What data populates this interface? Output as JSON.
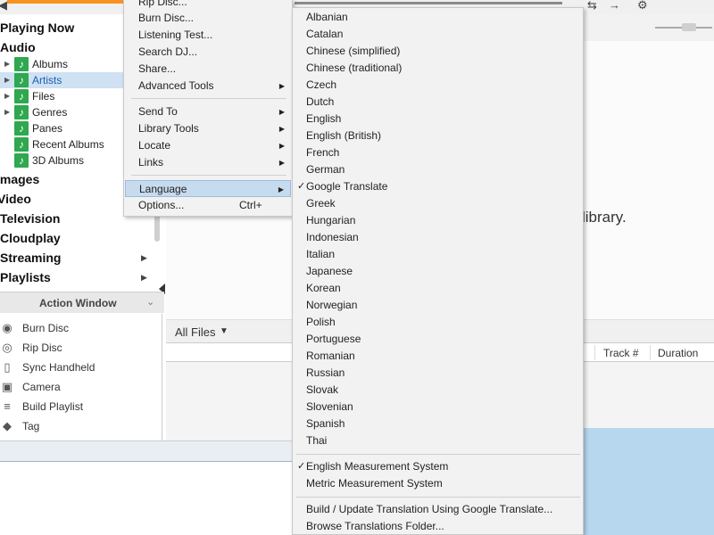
{
  "colors": {
    "progress": "#f7931e",
    "selected_row": "#cfe1f3",
    "menu_highlight": "#c7dbef",
    "note_icon": "#2fa84f"
  },
  "topbar": {
    "icons": [
      "speaker-icon",
      "swap-arrows-icon",
      "gear-icon"
    ]
  },
  "sidebar": {
    "categories": [
      {
        "label": "Playing Now"
      },
      {
        "label": "Audio"
      },
      {
        "label": "Images"
      },
      {
        "label": "Video"
      },
      {
        "label": "Television"
      },
      {
        "label": "Cloudplay"
      },
      {
        "label": "Streaming"
      },
      {
        "label": "Playlists"
      }
    ],
    "audio_items": [
      {
        "label": "Albums"
      },
      {
        "label": "Artists"
      },
      {
        "label": "Files"
      },
      {
        "label": "Genres"
      },
      {
        "label": "Panes"
      },
      {
        "label": "Recent Albums"
      },
      {
        "label": "3D Albums"
      }
    ]
  },
  "action_window": {
    "title": "Action Window",
    "items": [
      {
        "label": "Burn Disc",
        "icon": "disc-icon"
      },
      {
        "label": "Rip Disc",
        "icon": "rip-disc-icon"
      },
      {
        "label": "Sync Handheld",
        "icon": "phone-icon"
      },
      {
        "label": "Camera",
        "icon": "camera-icon"
      },
      {
        "label": "Build Playlist",
        "icon": "playlist-icon"
      },
      {
        "label": "Tag",
        "icon": "tag-icon"
      }
    ]
  },
  "main": {
    "library_text": "library.",
    "files_label": "All Files",
    "columns": {
      "track": "Track #",
      "duration": "Duration"
    }
  },
  "context_menu": {
    "items": [
      {
        "label": "Rip Disc..."
      },
      {
        "label": "Burn Disc..."
      },
      {
        "label": "Listening Test..."
      },
      {
        "label": "Search DJ..."
      },
      {
        "label": "Share..."
      },
      {
        "label": "Advanced Tools"
      },
      {
        "label": "Send To"
      },
      {
        "label": "Library Tools"
      },
      {
        "label": "Locate"
      },
      {
        "label": "Links"
      },
      {
        "label": "Language"
      },
      {
        "label": "Options..."
      }
    ],
    "options_shortcut": "Ctrl+"
  },
  "language_menu": {
    "languages": [
      "Albanian",
      "Catalan",
      "Chinese (simplified)",
      "Chinese (traditional)",
      "Czech",
      "Dutch",
      "English",
      "English (British)",
      "French",
      "German",
      "Google Translate",
      "Greek",
      "Hungarian",
      "Indonesian",
      "Italian",
      "Japanese",
      "Korean",
      "Norwegian",
      "Polish",
      "Portuguese",
      "Romanian",
      "Russian",
      "Slovak",
      "Slovenian",
      "Spanish",
      "Thai"
    ],
    "checked_language": "Google Translate",
    "measurement": [
      "English Measurement System",
      "Metric Measurement System"
    ],
    "checked_measurement": "English Measurement System",
    "actions": [
      "Build / Update Translation Using Google Translate...",
      "Browse Translations Folder..."
    ],
    "check_glyph": "✓"
  }
}
